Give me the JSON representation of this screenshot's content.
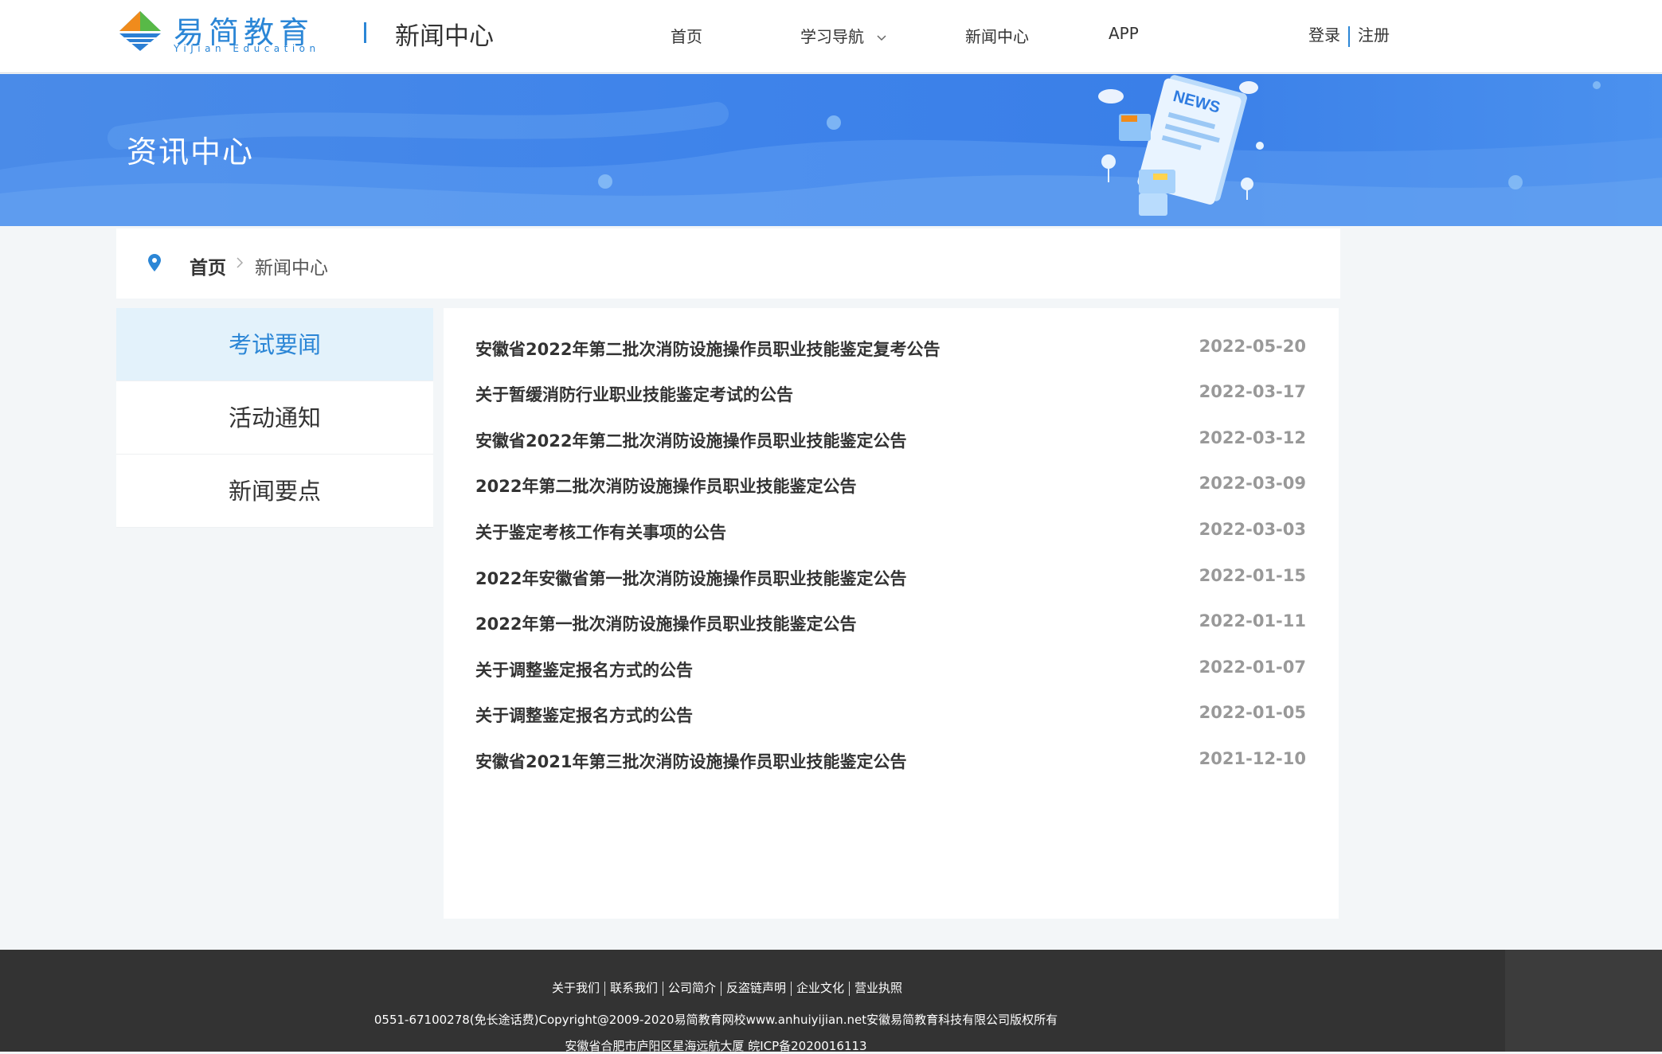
{
  "header": {
    "logo_text": "易简教育",
    "logo_sub": "YiJian Education",
    "section_title": "新闻中心",
    "nav": [
      {
        "label": "首页"
      },
      {
        "label": "学习导航"
      },
      {
        "label": "新闻中心"
      },
      {
        "label": "APP"
      }
    ],
    "login": "登录",
    "register": "注册"
  },
  "banner": {
    "title": "资讯中心",
    "illustration_text": "NEWS"
  },
  "breadcrumb": {
    "home": "首页",
    "current": "新闻中心"
  },
  "sidebar": {
    "items": [
      {
        "label": "考试要闻",
        "active": true
      },
      {
        "label": "活动通知",
        "active": false
      },
      {
        "label": "新闻要点",
        "active": false
      }
    ]
  },
  "news": [
    {
      "title": "安徽省2022年第二批次消防设施操作员职业技能鉴定复考公告",
      "date": "2022-05-20"
    },
    {
      "title": "关于暂缓消防行业职业技能鉴定考试的公告",
      "date": "2022-03-17"
    },
    {
      "title": "安徽省2022年第二批次消防设施操作员职业技能鉴定公告",
      "date": "2022-03-12"
    },
    {
      "title": "2022年第二批次消防设施操作员职业技能鉴定公告",
      "date": "2022-03-09"
    },
    {
      "title": "关于鉴定考核工作有关事项的公告",
      "date": "2022-03-03"
    },
    {
      "title": "2022年安徽省第一批次消防设施操作员职业技能鉴定公告",
      "date": "2022-01-15"
    },
    {
      "title": "2022年第一批次消防设施操作员职业技能鉴定公告",
      "date": "2022-01-11"
    },
    {
      "title": "关于调整鉴定报名方式的公告",
      "date": "2022-01-07"
    },
    {
      "title": "关于调整鉴定报名方式的公告",
      "date": "2022-01-05"
    },
    {
      "title": "安徽省2021年第三批次消防设施操作员职业技能鉴定公告",
      "date": "2021-12-10"
    }
  ],
  "footer": {
    "links": [
      "关于我们",
      "联系我们",
      "公司简介",
      "反盗链声明",
      "企业文化",
      "营业执照"
    ],
    "copyright": "0551-67100278(免长途话费)Copyright@2009-2020易简教育网校www.anhuiyijian.net安徽易简教育科技有限公司版权所有",
    "address": "安徽省合肥市庐阳区星海远航大厦 皖ICP备2020016113"
  },
  "colors": {
    "accent": "#2b86d6",
    "banner": "#3e83ea",
    "active_bg": "#e3f2fb",
    "footer": "#333333"
  }
}
